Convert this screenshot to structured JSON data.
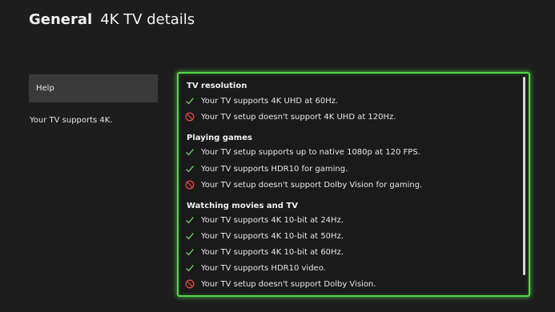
{
  "header": {
    "app": "General",
    "title": "4K TV details"
  },
  "sidebar": {
    "help_label": "Help",
    "summary": "Your TV supports 4K."
  },
  "colors": {
    "accent": "#53d64a",
    "ok": "#5dc957",
    "error": "#e0453c"
  },
  "sections": [
    {
      "heading": "TV resolution",
      "items": [
        {
          "icon": "check-icon",
          "status": "ok",
          "text": "Your TV supports 4K UHD at 60Hz."
        },
        {
          "icon": "blocked-icon",
          "status": "error",
          "text": "Your TV setup doesn't support 4K UHD at 120Hz."
        }
      ]
    },
    {
      "heading": "Playing games",
      "items": [
        {
          "icon": "check-icon",
          "status": "ok",
          "text": "Your TV setup supports up to native 1080p at 120 FPS."
        },
        {
          "icon": "check-icon",
          "status": "ok",
          "text": "Your TV supports HDR10 for gaming."
        },
        {
          "icon": "blocked-icon",
          "status": "error",
          "text": "Your TV setup doesn't support Dolby Vision for gaming."
        }
      ]
    },
    {
      "heading": "Watching movies and TV",
      "items": [
        {
          "icon": "check-icon",
          "status": "ok",
          "text": "Your TV supports 4K 10-bit at 24Hz."
        },
        {
          "icon": "check-icon",
          "status": "ok",
          "text": "Your TV supports 4K 10-bit at 50Hz."
        },
        {
          "icon": "check-icon",
          "status": "ok",
          "text": "Your TV supports 4K 10-bit at 60Hz."
        },
        {
          "icon": "check-icon",
          "status": "ok",
          "text": "Your TV supports HDR10 video."
        },
        {
          "icon": "blocked-icon",
          "status": "error",
          "text": "Your TV setup doesn't support Dolby Vision."
        }
      ]
    }
  ]
}
